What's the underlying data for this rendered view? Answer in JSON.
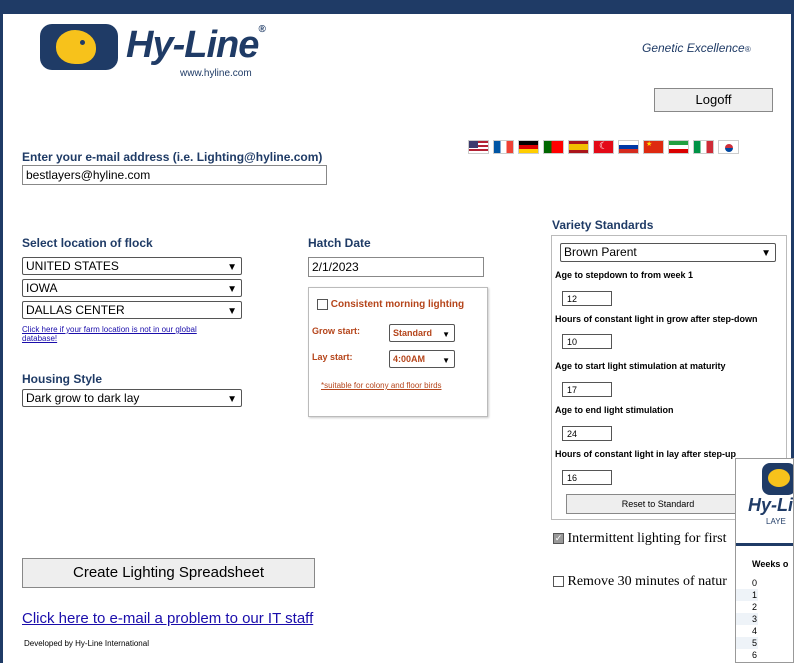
{
  "header": {
    "brand": "Hy-Line",
    "brand_mark": "®",
    "url": "www.hyline.com",
    "tagline": "Genetic Excellence",
    "tagline_mark": "®",
    "logoff_label": "Logoff"
  },
  "flags": [
    "us-flag",
    "fr-flag",
    "de-flag",
    "pt-flag",
    "es-flag",
    "tr-flag",
    "ru-flag",
    "cn-flag",
    "ir-flag",
    "it-flag",
    "kr-flag"
  ],
  "email": {
    "label": "Enter your e-mail address (i.e. Lighting@hyline.com)",
    "value": "bestlayers@hyline.com"
  },
  "location": {
    "label": "Select location of flock",
    "country": "UNITED STATES",
    "state": "IOWA",
    "city": "DALLAS CENTER",
    "not_found_link": "Click here if your farm location is not in our global database!"
  },
  "housing": {
    "label": "Housing Style",
    "value": "Dark grow to dark lay"
  },
  "hatch": {
    "label": "Hatch Date",
    "value": "2/1/2023"
  },
  "morning_lighting": {
    "label": "Consistent morning lighting",
    "grow_label": "Grow start:",
    "grow_value": "Standard",
    "lay_label": "Lay start:",
    "lay_value": "4:00AM",
    "note": "*suitable for colony and floor birds"
  },
  "variety": {
    "title": "Variety Standards",
    "selected": "Brown Parent",
    "fields": [
      {
        "label": "Age to stepdown to from week 1",
        "value": "12"
      },
      {
        "label": "Hours of constant light in grow after step-down",
        "value": "10"
      },
      {
        "label": "Age to start light stimulation at maturity",
        "value": "17"
      },
      {
        "label": "Age to end light stimulation",
        "value": "24"
      },
      {
        "label": "Hours of constant light in lay after step-up",
        "value": "16"
      }
    ],
    "reset_label": "Reset to Standard"
  },
  "options": {
    "intermittent": "Intermittent lighting for first",
    "remove_natural": "Remove 30 minutes of natur"
  },
  "create_button": "Create Lighting Spreadsheet",
  "it_link": "Click here to e-mail a problem to our IT staff",
  "footer": "Developed by Hy-Line International",
  "overlay": {
    "brand": "Hy-Li",
    "subtitle": "LAYE",
    "col_header": "Weeks o",
    "rows": [
      "0",
      "1",
      "2",
      "3",
      "4",
      "5",
      "6"
    ]
  }
}
